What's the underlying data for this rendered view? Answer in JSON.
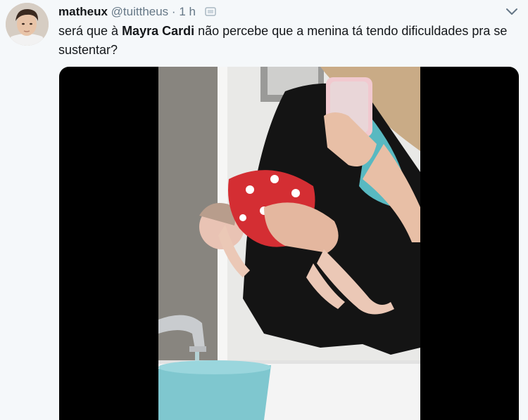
{
  "tweet": {
    "display_name": "matheux",
    "handle": "@tuittheus",
    "separator": "·",
    "time": "1 h",
    "text_before": "será que à ",
    "mention": "Mayra Cardi",
    "text_after": " não percebe que a menina tá tendo dificuldades pra se sustentar?"
  },
  "icons": {
    "caret": "chevron-down-icon",
    "small_icon": "verified-icon"
  },
  "colors": {
    "background": "#f5f8fa",
    "secondary_text": "#657786",
    "media_background": "#000000"
  }
}
